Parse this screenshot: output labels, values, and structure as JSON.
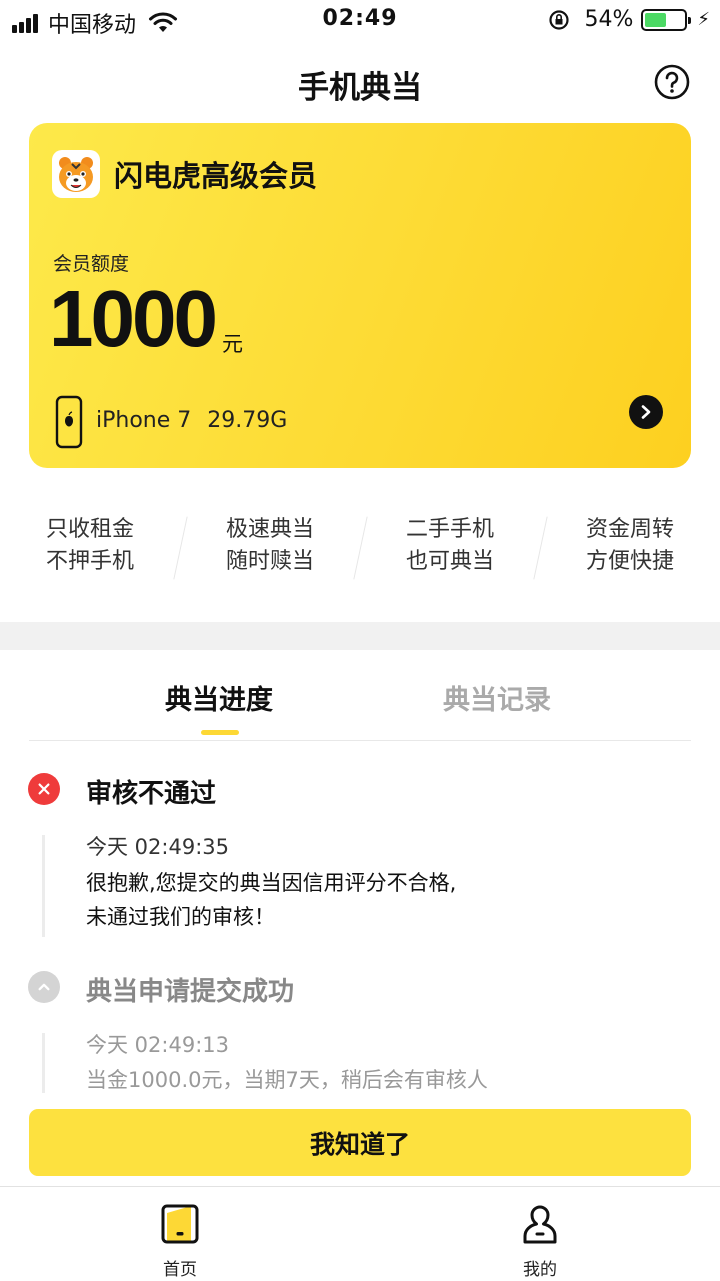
{
  "status_bar": {
    "carrier": "中国移动",
    "time": "02:49",
    "battery": "54%"
  },
  "header": {
    "title": "手机典当"
  },
  "member_card": {
    "title": "闪电虎高级会员",
    "quota_label": "会员额度",
    "quota_amount": "1000",
    "quota_unit": "元",
    "device_model": "iPhone 7",
    "device_storage": "29.79G"
  },
  "features": [
    {
      "line1": "只收租金",
      "line2": "不押手机"
    },
    {
      "line1": "极速典当",
      "line2": "随时赎当"
    },
    {
      "line1": "二手手机",
      "line2": "也可典当"
    },
    {
      "line1": "资金周转",
      "line2": "方便快捷"
    }
  ],
  "tabs": {
    "progress": "典当进度",
    "records": "典当记录"
  },
  "timeline": [
    {
      "status": "审核不通过",
      "time": "今天 02:49:35",
      "desc_line1": "很抱歉,您提交的典当因信用评分不合格,",
      "desc_line2": "未通过我们的审核！"
    },
    {
      "status": "典当申请提交成功",
      "time": "今天 02:49:13",
      "desc_line1": "当金1000.0元，当期7天，稍后会有审核人"
    }
  ],
  "confirm_button": "我知道了",
  "bottom_nav": {
    "home": "首页",
    "mine": "我的"
  },
  "colors": {
    "accent": "#fde13f",
    "error": "#ef3b3b",
    "inactive": "#aaaaaa"
  }
}
